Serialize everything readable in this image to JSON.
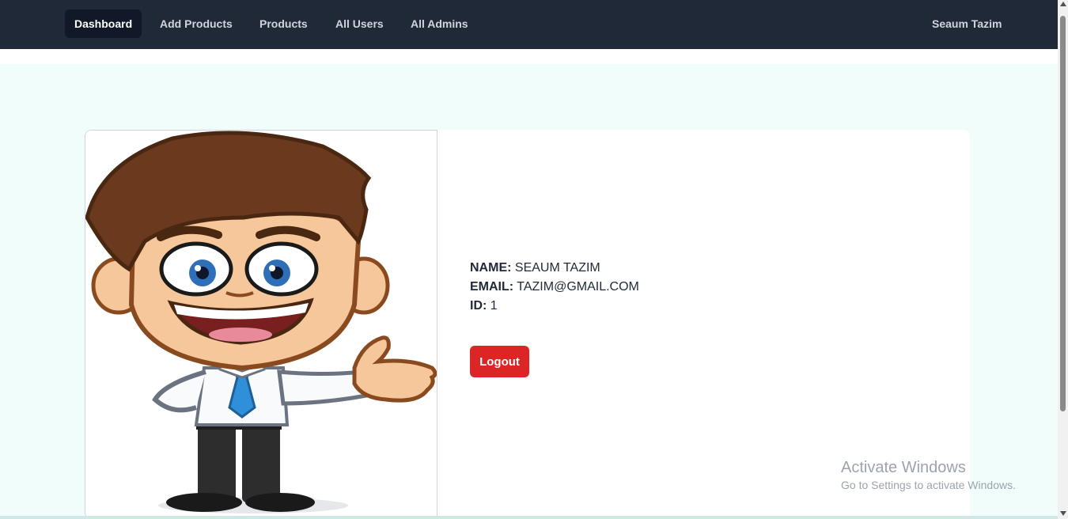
{
  "nav": {
    "items": [
      {
        "label": "Dashboard",
        "active": true
      },
      {
        "label": "Add Products",
        "active": false
      },
      {
        "label": "Products",
        "active": false
      },
      {
        "label": "All Users",
        "active": false
      },
      {
        "label": "All Admins",
        "active": false
      }
    ],
    "user_name": "Seaum Tazim"
  },
  "profile": {
    "avatar_icon": "businessman-cartoon-illustration",
    "name_label": "NAME:",
    "name_value": "SEAUM TAZIM",
    "email_label": "EMAIL:",
    "email_value": "TAZIM@GMAIL.COM",
    "id_label": "ID:",
    "id_value": "1",
    "logout_label": "Logout"
  },
  "watermark": {
    "title": "Activate Windows",
    "subtitle": "Go to Settings to activate Windows."
  },
  "colors": {
    "navbar": "#1f2937",
    "nav_active": "#111827",
    "page_bg": "#f0fdfa",
    "logout": "#dc2626"
  }
}
